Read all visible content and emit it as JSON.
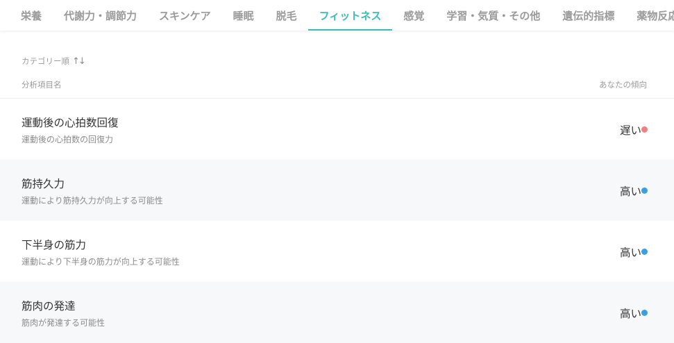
{
  "tabs": [
    {
      "label": "栄養",
      "active": false
    },
    {
      "label": "代謝力・調節力",
      "active": false
    },
    {
      "label": "スキンケア",
      "active": false
    },
    {
      "label": "睡眠",
      "active": false
    },
    {
      "label": "脱毛",
      "active": false
    },
    {
      "label": "フィットネス",
      "active": true
    },
    {
      "label": "感覚",
      "active": false
    },
    {
      "label": "学習・気質・その他",
      "active": false
    },
    {
      "label": "遺伝的指標",
      "active": false
    },
    {
      "label": "薬物反応",
      "active": false
    }
  ],
  "header": {
    "sort_label": "カテゴリー順",
    "sort_icon": "sort-arrows-icon",
    "col_left": "分析項目名",
    "col_right": "あなたの傾向"
  },
  "colors": {
    "accent": "#3dbcb5",
    "dot_red": "#f08080",
    "dot_blue": "#3a9ee0"
  },
  "rows": [
    {
      "title": "運動後の心拍数回復",
      "subtitle": "運動後の心拍数の回復力",
      "value": "遅い",
      "dot": "red"
    },
    {
      "title": "筋持久力",
      "subtitle": "運動により筋持久力が向上する可能性",
      "value": "高い",
      "dot": "blue"
    },
    {
      "title": "下半身の筋力",
      "subtitle": "運動により下半身の筋力が向上する可能性",
      "value": "高い",
      "dot": "blue"
    },
    {
      "title": "筋肉の発達",
      "subtitle": "筋肉が発達する可能性",
      "value": "高い",
      "dot": "blue"
    }
  ]
}
